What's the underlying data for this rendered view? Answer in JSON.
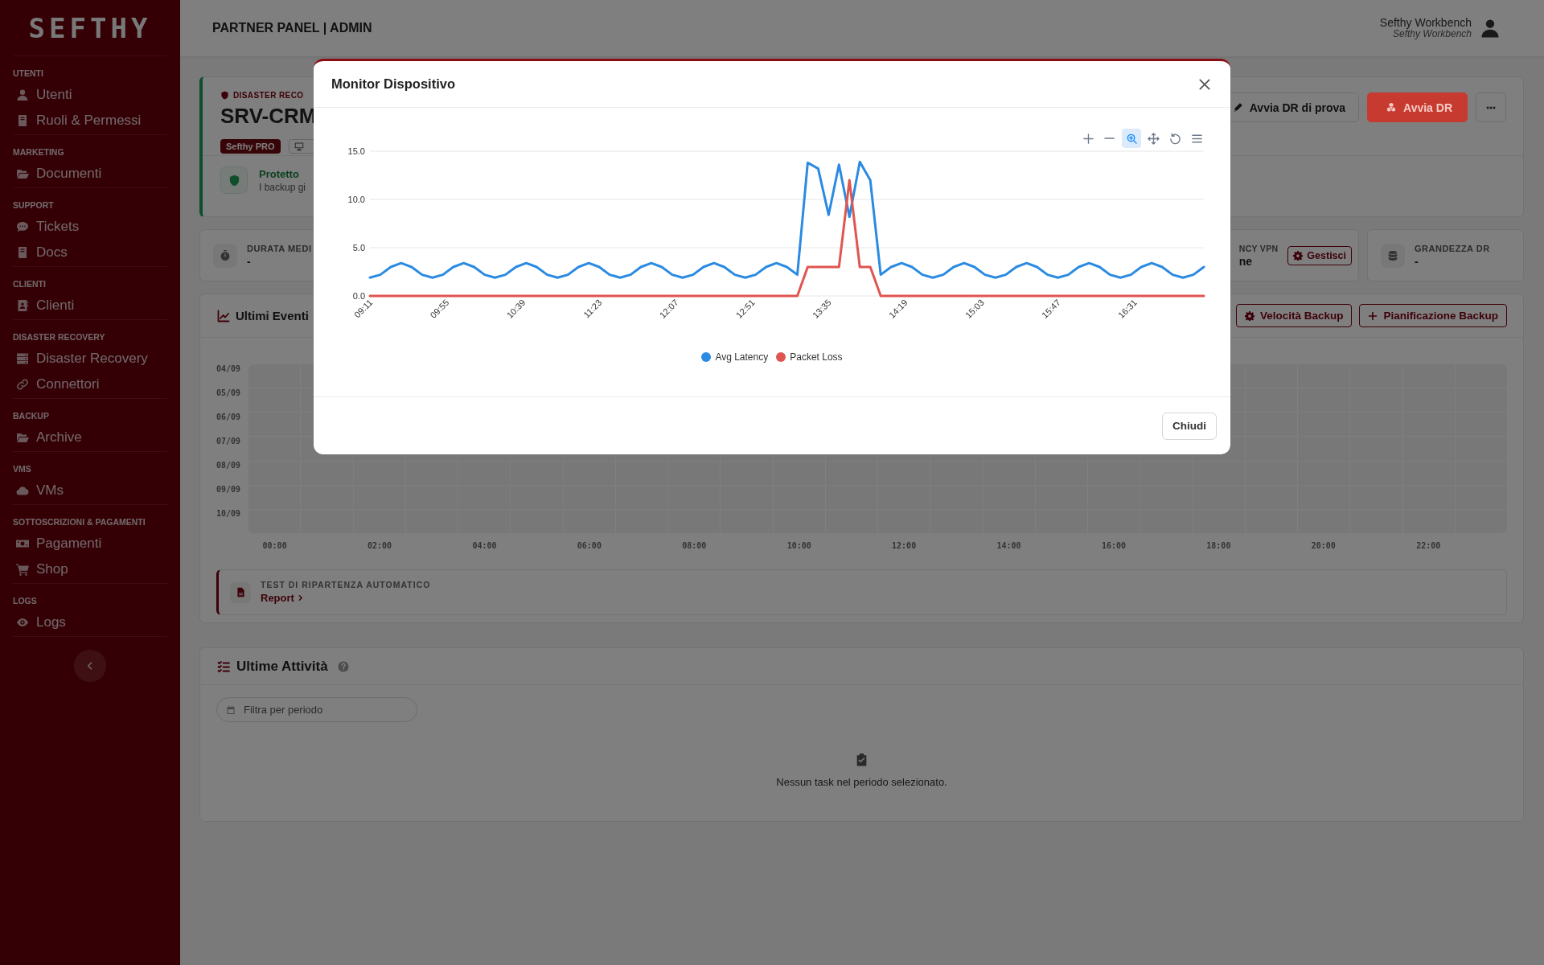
{
  "sidebar": {
    "logo": "SEFTHY",
    "sections": [
      {
        "title": "UTENTI",
        "items": [
          "Utenti",
          "Ruoli & Permessi"
        ]
      },
      {
        "title": "MARKETING",
        "items": [
          "Documenti"
        ]
      },
      {
        "title": "SUPPORT",
        "items": [
          "Tickets",
          "Docs"
        ]
      },
      {
        "title": "CLIENTI",
        "items": [
          "Clienti"
        ]
      },
      {
        "title": "DISASTER RECOVERY",
        "items": [
          "Disaster Recovery",
          "Connettori"
        ]
      },
      {
        "title": "BACKUP",
        "items": [
          "Archive"
        ]
      },
      {
        "title": "VMS",
        "items": [
          "VMs"
        ]
      },
      {
        "title": "SOTTOSCRIZIONI & PAGAMENTI",
        "items": [
          "Pagamenti",
          "Shop"
        ]
      },
      {
        "title": "LOGS",
        "items": [
          "Logs"
        ]
      }
    ]
  },
  "header": {
    "title": "PARTNER PANEL | ADMIN",
    "user_name": "Sefthy Workbench",
    "user_subtitle": "Sefthy Workbench"
  },
  "dr_card": {
    "eyebrow": "DISASTER RECO",
    "name": "SRV-CRM",
    "badge": "Sefthy PRO",
    "status": "Protetto",
    "status_text": "I backup gi",
    "buttons": [
      {
        "label": "Avvia DR di prova",
        "kind": "outline"
      },
      {
        "label": "Avvia DR",
        "kind": "danger"
      },
      {
        "kind": "more"
      }
    ]
  },
  "stats": [
    {
      "label": "DURATA MEDI",
      "value": "-",
      "kind": "duration"
    },
    {
      "label": "NCY VPN",
      "value": "ne",
      "action": "Gestisci",
      "kind": "vpn"
    },
    {
      "label": "GRANDEZZA DR",
      "value": "-",
      "kind": "size"
    }
  ],
  "events": {
    "title": "Ultimi Eventi",
    "buttons": [
      "Velocità Backup",
      "Pianificazione Backup"
    ],
    "heatmap": {
      "rows": [
        "04/09",
        "05/09",
        "06/09",
        "07/09",
        "08/09",
        "09/09",
        "10/09"
      ],
      "columns": [
        "00:00",
        "02:00",
        "04:00",
        "06:00",
        "08:00",
        "10:00",
        "12:00",
        "14:00",
        "16:00",
        "18:00",
        "20:00",
        "22:00"
      ]
    },
    "test": {
      "title": "TEST DI RIPARTENZA AUTOMATICO",
      "link": "Report"
    }
  },
  "activity": {
    "title": "Ultime Attività",
    "filter": {
      "placeholder": "Filtra per periodo"
    },
    "empty_text": "Nessun task nel periodo selezionato."
  },
  "modal": {
    "title": "Monitor Dispositivo",
    "toolbar": [
      {
        "kind": "zoom-in",
        "selected": false
      },
      {
        "kind": "zoom-out",
        "selected": false
      },
      {
        "kind": "zoom-select",
        "selected": true
      },
      {
        "kind": "pan",
        "selected": false
      },
      {
        "kind": "reset",
        "selected": false
      },
      {
        "kind": "menu",
        "selected": false
      }
    ],
    "chart_data": {
      "type": "line",
      "x": [
        551,
        557,
        563,
        569,
        575,
        581,
        587,
        593,
        599,
        605,
        611,
        617,
        623,
        629,
        635,
        641,
        647,
        653,
        659,
        665,
        671,
        677,
        683,
        689,
        695,
        701,
        707,
        713,
        719,
        725,
        731,
        737,
        743,
        749,
        755,
        761,
        767,
        773,
        779,
        785,
        791,
        797,
        803,
        809,
        815,
        821,
        827,
        833,
        839,
        845,
        851,
        857,
        863,
        869,
        875,
        881,
        887,
        893,
        899,
        905,
        911,
        917,
        923,
        929,
        935,
        941,
        947,
        953,
        959,
        965,
        971,
        977,
        983,
        989,
        995,
        1001,
        1007,
        1013,
        1019,
        1025,
        1031
      ],
      "series": [
        {
          "name": "Avg Latency",
          "color": "#2b8ae2",
          "values": [
            1.9,
            2.2,
            3.0,
            3.4,
            3.0,
            2.2,
            1.9,
            2.2,
            3.0,
            3.4,
            3.0,
            2.2,
            1.9,
            2.2,
            3.0,
            3.4,
            3.0,
            2.2,
            1.9,
            2.2,
            3.0,
            3.4,
            3.0,
            2.2,
            1.9,
            2.2,
            3.0,
            3.4,
            3.0,
            2.2,
            1.9,
            2.2,
            3.0,
            3.4,
            3.0,
            2.2,
            1.9,
            2.2,
            3.0,
            3.4,
            3.0,
            2.2,
            13.8,
            13.2,
            8.4,
            13.6,
            8.2,
            13.9,
            12.0,
            2.2,
            3.0,
            3.4,
            3.0,
            2.2,
            1.9,
            2.2,
            3.0,
            3.4,
            3.0,
            2.2,
            1.9,
            2.2,
            3.0,
            3.4,
            3.0,
            2.2,
            1.9,
            2.2,
            3.0,
            3.4,
            3.0,
            2.2,
            1.9,
            2.2,
            3.0,
            3.4,
            3.0,
            2.2,
            1.9,
            2.2,
            3.0
          ]
        },
        {
          "name": "Packet Loss",
          "color": "#e05550",
          "values": [
            0,
            0,
            0,
            0,
            0,
            0,
            0,
            0,
            0,
            0,
            0,
            0,
            0,
            0,
            0,
            0,
            0,
            0,
            0,
            0,
            0,
            0,
            0,
            0,
            0,
            0,
            0,
            0,
            0,
            0,
            0,
            0,
            0,
            0,
            0,
            0,
            0,
            0,
            0,
            0,
            0,
            0,
            3,
            3,
            3,
            3,
            12,
            3,
            3,
            0,
            0,
            0,
            0,
            0,
            0,
            0,
            0,
            0,
            0,
            0,
            0,
            0,
            0,
            0,
            0,
            0,
            0,
            0,
            0,
            0,
            0,
            0,
            0,
            0,
            0,
            0,
            0,
            0,
            0,
            0,
            0
          ]
        }
      ],
      "xlim": [
        551,
        1031
      ],
      "ylim": [
        0,
        15
      ],
      "xticks": [
        {
          "value": 551,
          "label": "09:11"
        },
        {
          "value": 595,
          "label": "09:55"
        },
        {
          "value": 639,
          "label": "10:39"
        },
        {
          "value": 683,
          "label": "11:23"
        },
        {
          "value": 727,
          "label": "12:07"
        },
        {
          "value": 771,
          "label": "12:51"
        },
        {
          "value": 815,
          "label": "13:35"
        },
        {
          "value": 859,
          "label": "14:19"
        },
        {
          "value": 903,
          "label": "15:03"
        },
        {
          "value": 947,
          "label": "15:47"
        },
        {
          "value": 991,
          "label": "16:31"
        }
      ],
      "yticks": [
        {
          "value": 0,
          "label": "0.0"
        },
        {
          "value": 5,
          "label": "5.0"
        },
        {
          "value": 10,
          "label": "10.0"
        },
        {
          "value": 15,
          "label": "15.0"
        }
      ]
    },
    "button": "Chiudi"
  }
}
